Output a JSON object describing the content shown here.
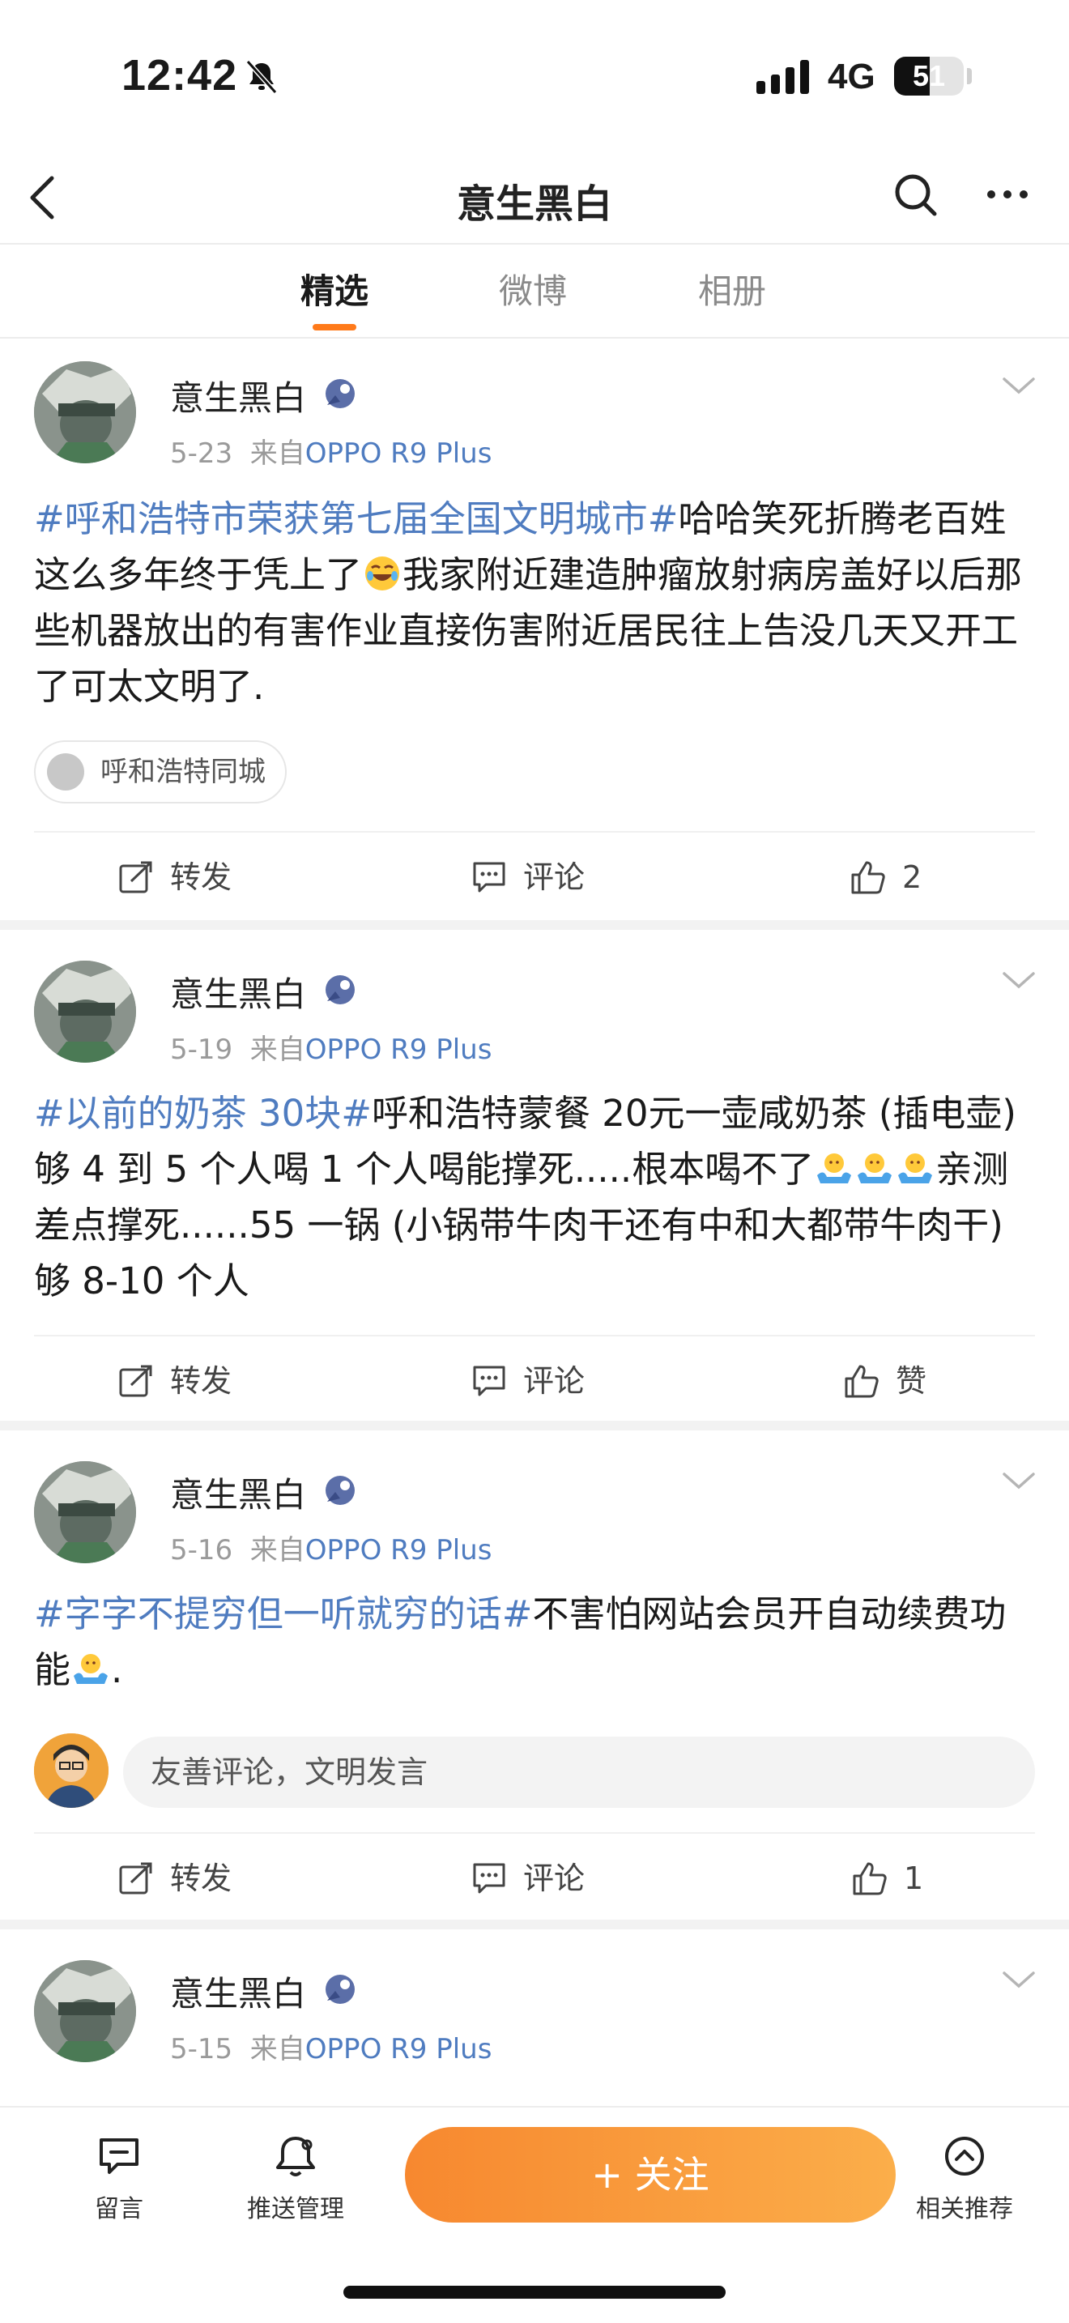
{
  "status": {
    "time": "12:42",
    "network": "4G",
    "battery": "51",
    "battery_level": 0.51
  },
  "nav": {
    "title": "意生黑白"
  },
  "tabs": [
    {
      "label": "精选",
      "active": true
    },
    {
      "label": "微博",
      "active": false
    },
    {
      "label": "相册",
      "active": false
    }
  ],
  "posts": [
    {
      "author": "意生黑白",
      "date": "5-23",
      "source_prefix": "来自",
      "source": "OPPO R9 Plus",
      "topic": "#呼和浩特市荣获第七届全国文明城市#",
      "text": "哈哈笑死折腾老百姓这么多年终于凭上了",
      "text2": "我家附近建造肿瘤放射病房盖好以后那些机器放出的有害作业直接伤害附近居民往上告没几天又开工了可太文明了.",
      "tag": "呼和浩特同城",
      "repost": "转发",
      "comment": "评论",
      "like": "2"
    },
    {
      "author": "意生黑白",
      "date": "5-19",
      "source_prefix": "来自",
      "source": "OPPO R9 Plus",
      "topic": "#以前的奶茶 30块#",
      "text": "呼和浩特蒙餐 20元一壶咸奶茶 (插电壶) 够 4 到 5 个人喝 1 个人喝能撑死.....根本喝不了",
      "text2": "亲测差点撑死......55 一锅 (小锅带牛肉干还有中和大都带牛肉干) 够 8-10 个人",
      "repost": "转发",
      "comment": "评论",
      "like": "赞"
    },
    {
      "author": "意生黑白",
      "date": "5-16",
      "source_prefix": "来自",
      "source": "OPPO R9 Plus",
      "topic": "#字字不提穷但一听就穷的话#",
      "text": "不害怕网站会员开自动续费功能",
      "text2": ".",
      "comment_placeholder": "友善评论，文明发言",
      "repost": "转发",
      "comment": "评论",
      "like": "1"
    },
    {
      "author": "意生黑白",
      "date": "5-15",
      "source_prefix": "来自",
      "source": "OPPO R9 Plus"
    }
  ],
  "bottom": {
    "message": "留言",
    "push": "推送管理",
    "follow": "+ 关注",
    "related": "相关推荐"
  },
  "colors": {
    "accent": "#ff7a1a",
    "link": "#4f7cc0",
    "follow_start": "#f7882f",
    "follow_end": "#fbae4a"
  },
  "icons": [
    "back-icon",
    "search-icon",
    "more-icon",
    "chevron-down-icon",
    "repost-icon",
    "comment-icon",
    "like-icon",
    "message-icon",
    "push-bell-icon",
    "related-icon"
  ]
}
